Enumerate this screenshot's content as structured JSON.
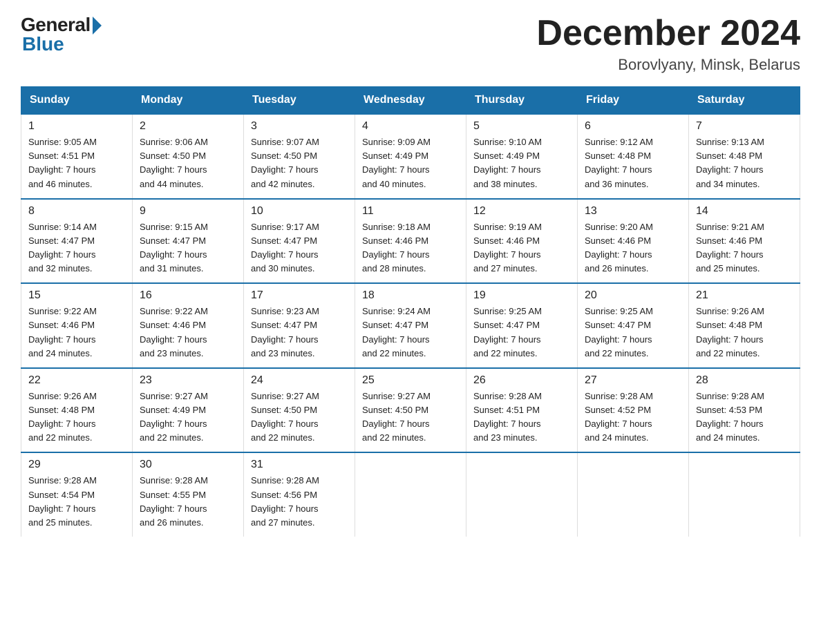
{
  "logo": {
    "general": "General",
    "blue": "Blue"
  },
  "title": {
    "month_year": "December 2024",
    "location": "Borovlyany, Minsk, Belarus"
  },
  "headers": [
    "Sunday",
    "Monday",
    "Tuesday",
    "Wednesday",
    "Thursday",
    "Friday",
    "Saturday"
  ],
  "weeks": [
    [
      {
        "day": "1",
        "sunrise": "9:05 AM",
        "sunset": "4:51 PM",
        "daylight": "7 hours and 46 minutes."
      },
      {
        "day": "2",
        "sunrise": "9:06 AM",
        "sunset": "4:50 PM",
        "daylight": "7 hours and 44 minutes."
      },
      {
        "day": "3",
        "sunrise": "9:07 AM",
        "sunset": "4:50 PM",
        "daylight": "7 hours and 42 minutes."
      },
      {
        "day": "4",
        "sunrise": "9:09 AM",
        "sunset": "4:49 PM",
        "daylight": "7 hours and 40 minutes."
      },
      {
        "day": "5",
        "sunrise": "9:10 AM",
        "sunset": "4:49 PM",
        "daylight": "7 hours and 38 minutes."
      },
      {
        "day": "6",
        "sunrise": "9:12 AM",
        "sunset": "4:48 PM",
        "daylight": "7 hours and 36 minutes."
      },
      {
        "day": "7",
        "sunrise": "9:13 AM",
        "sunset": "4:48 PM",
        "daylight": "7 hours and 34 minutes."
      }
    ],
    [
      {
        "day": "8",
        "sunrise": "9:14 AM",
        "sunset": "4:47 PM",
        "daylight": "7 hours and 32 minutes."
      },
      {
        "day": "9",
        "sunrise": "9:15 AM",
        "sunset": "4:47 PM",
        "daylight": "7 hours and 31 minutes."
      },
      {
        "day": "10",
        "sunrise": "9:17 AM",
        "sunset": "4:47 PM",
        "daylight": "7 hours and 30 minutes."
      },
      {
        "day": "11",
        "sunrise": "9:18 AM",
        "sunset": "4:46 PM",
        "daylight": "7 hours and 28 minutes."
      },
      {
        "day": "12",
        "sunrise": "9:19 AM",
        "sunset": "4:46 PM",
        "daylight": "7 hours and 27 minutes."
      },
      {
        "day": "13",
        "sunrise": "9:20 AM",
        "sunset": "4:46 PM",
        "daylight": "7 hours and 26 minutes."
      },
      {
        "day": "14",
        "sunrise": "9:21 AM",
        "sunset": "4:46 PM",
        "daylight": "7 hours and 25 minutes."
      }
    ],
    [
      {
        "day": "15",
        "sunrise": "9:22 AM",
        "sunset": "4:46 PM",
        "daylight": "7 hours and 24 minutes."
      },
      {
        "day": "16",
        "sunrise": "9:22 AM",
        "sunset": "4:46 PM",
        "daylight": "7 hours and 23 minutes."
      },
      {
        "day": "17",
        "sunrise": "9:23 AM",
        "sunset": "4:47 PM",
        "daylight": "7 hours and 23 minutes."
      },
      {
        "day": "18",
        "sunrise": "9:24 AM",
        "sunset": "4:47 PM",
        "daylight": "7 hours and 22 minutes."
      },
      {
        "day": "19",
        "sunrise": "9:25 AM",
        "sunset": "4:47 PM",
        "daylight": "7 hours and 22 minutes."
      },
      {
        "day": "20",
        "sunrise": "9:25 AM",
        "sunset": "4:47 PM",
        "daylight": "7 hours and 22 minutes."
      },
      {
        "day": "21",
        "sunrise": "9:26 AM",
        "sunset": "4:48 PM",
        "daylight": "7 hours and 22 minutes."
      }
    ],
    [
      {
        "day": "22",
        "sunrise": "9:26 AM",
        "sunset": "4:48 PM",
        "daylight": "7 hours and 22 minutes."
      },
      {
        "day": "23",
        "sunrise": "9:27 AM",
        "sunset": "4:49 PM",
        "daylight": "7 hours and 22 minutes."
      },
      {
        "day": "24",
        "sunrise": "9:27 AM",
        "sunset": "4:50 PM",
        "daylight": "7 hours and 22 minutes."
      },
      {
        "day": "25",
        "sunrise": "9:27 AM",
        "sunset": "4:50 PM",
        "daylight": "7 hours and 22 minutes."
      },
      {
        "day": "26",
        "sunrise": "9:28 AM",
        "sunset": "4:51 PM",
        "daylight": "7 hours and 23 minutes."
      },
      {
        "day": "27",
        "sunrise": "9:28 AM",
        "sunset": "4:52 PM",
        "daylight": "7 hours and 24 minutes."
      },
      {
        "day": "28",
        "sunrise": "9:28 AM",
        "sunset": "4:53 PM",
        "daylight": "7 hours and 24 minutes."
      }
    ],
    [
      {
        "day": "29",
        "sunrise": "9:28 AM",
        "sunset": "4:54 PM",
        "daylight": "7 hours and 25 minutes."
      },
      {
        "day": "30",
        "sunrise": "9:28 AM",
        "sunset": "4:55 PM",
        "daylight": "7 hours and 26 minutes."
      },
      {
        "day": "31",
        "sunrise": "9:28 AM",
        "sunset": "4:56 PM",
        "daylight": "7 hours and 27 minutes."
      },
      null,
      null,
      null,
      null
    ]
  ],
  "labels": {
    "sunrise": "Sunrise:",
    "sunset": "Sunset:",
    "daylight": "Daylight:"
  }
}
